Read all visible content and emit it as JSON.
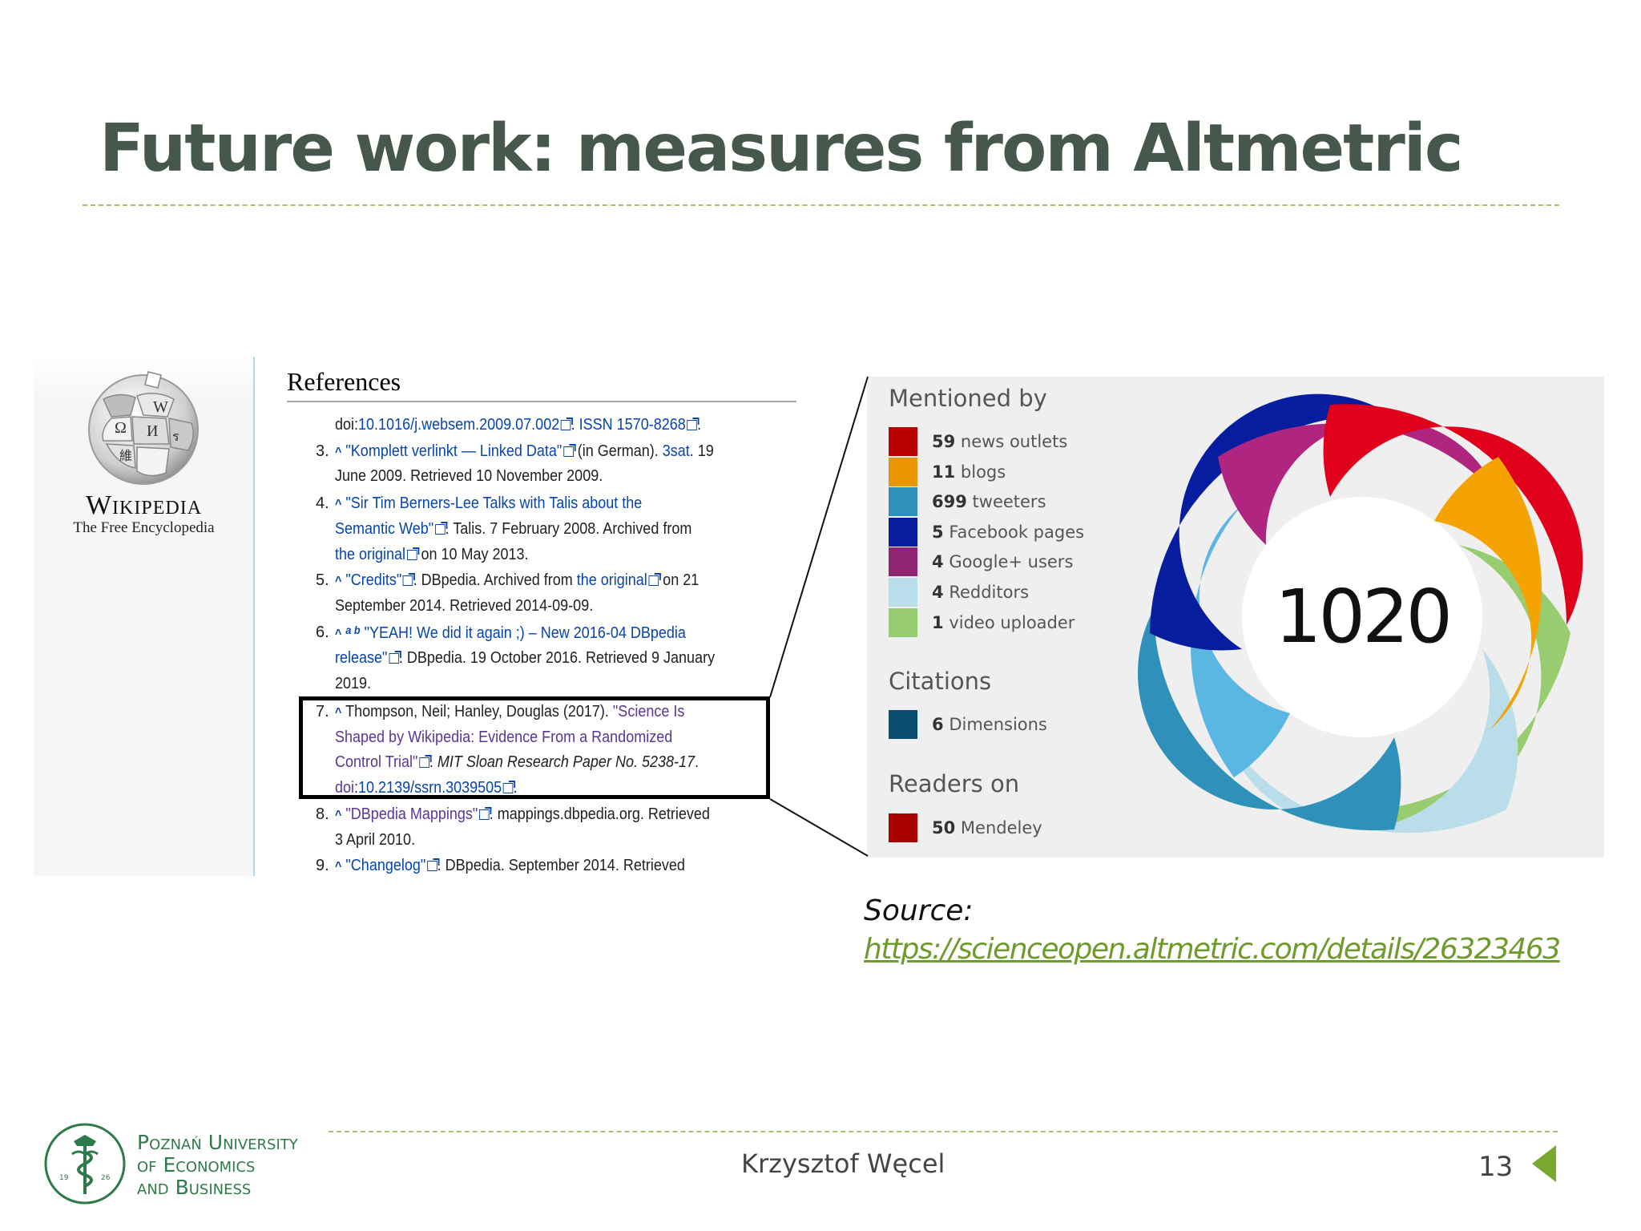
{
  "slide": {
    "title": "Future work: measures from Altmetric",
    "page_number": "13",
    "author": "Krzysztof Węcel"
  },
  "wikipedia": {
    "wordmark": "Wikipedia",
    "tagline": "The Free Encyclopedia",
    "references_heading": "References"
  },
  "references": {
    "r2_a": "doi:",
    "r2_b": "10.1016/j.websem.2009.07.002",
    "r2_c": ". ",
    "r2_d": "ISSN",
    "r2_e": " ",
    "r2_f": "1570-8268",
    "r2_g": ".",
    "r3_num": "3.",
    "r3_a": "\"Komplett verlinkt — Linked Data\"",
    "r3_b": " (in German). ",
    "r3_c": "3sat",
    "r3_d": ". 19",
    "r3_line2": "June 2009. Retrieved 10 November 2009.",
    "r4_num": "4.",
    "r4_a": "\"Sir Tim Berners-Lee Talks with Talis about the",
    "r4_b": "Semantic Web\"",
    "r4_c": ". Talis. 7 February 2008. Archived from",
    "r4_d": "the original",
    "r4_e": " on 10 May 2013.",
    "r5_num": "5.",
    "r5_a": "\"Credits\"",
    "r5_b": ". DBpedia. Archived from ",
    "r5_c": "the original",
    "r5_d": " on 21",
    "r5_line2": "September 2014. Retrieved 2014-09-09.",
    "r6_num": "6.",
    "r6_a": "a b",
    "r6_b": "\"YEAH! We did it again ;) – New 2016-04 DBpedia",
    "r6_c": "release\"",
    "r6_d": ". DBpedia. 19 October 2016. Retrieved 9 January",
    "r6_line3": "2019.",
    "r7_num": "7.",
    "r7_a": "Thompson, Neil; Hanley, Douglas (2017). ",
    "r7_b": "\"Science Is",
    "r7_line2": "Shaped by Wikipedia: Evidence From a Randomized",
    "r7_c": "Control Trial\"",
    "r7_d": ". ",
    "r7_e": "MIT Sloan Research Paper No. 5238-17",
    "r7_f": ".",
    "r7_g": "doi",
    "r7_h": ":",
    "r7_i": "10.2139/ssrn.3039505",
    "r7_j": ".",
    "r8_num": "8.",
    "r8_a": "\"DBpedia Mappings\"",
    "r8_b": ". mappings.dbpedia.org. Retrieved",
    "r8_line2": "3 April 2010.",
    "r9_num": "9.",
    "r9_a": "\"Changelog\"",
    "r9_b": ". DBpedia. September 2014. Retrieved"
  },
  "altmetric": {
    "score": "1020",
    "mentioned_heading": "Mentioned by",
    "citations_heading": "Citations",
    "readers_heading": "Readers on",
    "mentions": [
      {
        "count": "59",
        "label": "news outlets",
        "color": "#b80000"
      },
      {
        "count": "11",
        "label": "blogs",
        "color": "#e89500"
      },
      {
        "count": "699",
        "label": "tweeters",
        "color": "#2f90b9"
      },
      {
        "count": "5",
        "label": "Facebook pages",
        "color": "#071d9f"
      },
      {
        "count": "4",
        "label": "Google+ users",
        "color": "#912470"
      },
      {
        "count": "4",
        "label": "Redditors",
        "color": "#b9dde9"
      },
      {
        "count": "1",
        "label": "video uploader",
        "color": "#98cc70"
      }
    ],
    "citations": [
      {
        "count": "6",
        "label": "Dimensions",
        "color": "#0a4c6d"
      }
    ],
    "readers": [
      {
        "count": "50",
        "label": "Mendeley",
        "color": "#a60000"
      }
    ]
  },
  "source": {
    "label": "Source:",
    "url": "https://scienceopen.altmetric.com/details/26323463"
  },
  "university": {
    "line1": "Poznań University",
    "line2": "of Economics",
    "line3": "and Business"
  }
}
